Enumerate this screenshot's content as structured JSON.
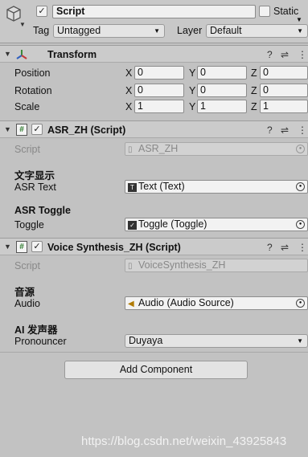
{
  "header": {
    "object_name": "Script",
    "static_label": "Static",
    "tag_label": "Tag",
    "tag_value": "Untagged",
    "layer_label": "Layer",
    "layer_value": "Default"
  },
  "transform": {
    "title": "Transform",
    "rows": [
      {
        "label": "Position",
        "x": "0",
        "y": "0",
        "z": "0"
      },
      {
        "label": "Rotation",
        "x": "0",
        "y": "0",
        "z": "0"
      },
      {
        "label": "Scale",
        "x": "1",
        "y": "1",
        "z": "1"
      }
    ],
    "axes": {
      "x": "X",
      "y": "Y",
      "z": "Z"
    }
  },
  "asr": {
    "title": "ASR_ZH (Script)",
    "script_label": "Script",
    "script_value": "ASR_ZH",
    "section1": "文字显示",
    "field1_label": "ASR Text",
    "field1_value": "Text (Text)",
    "section2": "ASR Toggle",
    "field2_label": "Toggle",
    "field2_value": "Toggle (Toggle)"
  },
  "voice": {
    "title": "Voice Synthesis_ZH (Script)",
    "script_label": "Script",
    "script_value": "VoiceSynthesis_ZH",
    "section1": "音源",
    "field1_label": "Audio",
    "field1_value": "Audio (Audio Source)",
    "section2": "AI 发声器",
    "field2_label": "Pronouncer",
    "field2_value": "Duyaya"
  },
  "add_component": "Add Component",
  "watermark": "https://blog.csdn.net/weixin_43925843"
}
